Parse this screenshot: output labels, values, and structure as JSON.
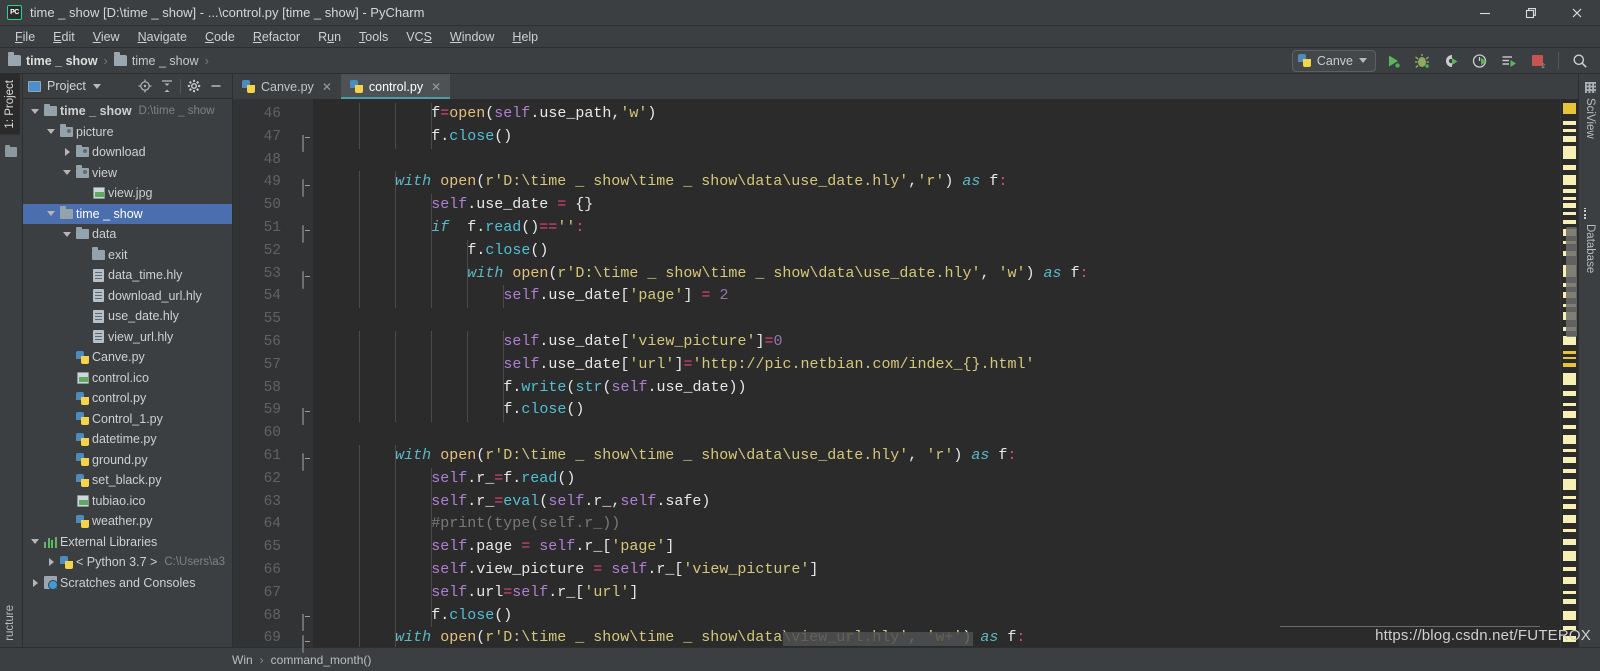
{
  "window": {
    "title": "time _ show [D:\\time _ show] - ...\\control.py [time _ show] - PyCharm",
    "logo_text": "PC",
    "minimize": "─",
    "maximize": "❐",
    "close": "✕"
  },
  "menubar": {
    "items": [
      "File",
      "Edit",
      "View",
      "Navigate",
      "Code",
      "Refactor",
      "Run",
      "Tools",
      "VCS",
      "Window",
      "Help"
    ]
  },
  "breadcrumb": {
    "items": [
      "time _ show",
      "time _ show"
    ],
    "separator": "›"
  },
  "toolbar": {
    "run_config": "Canve",
    "buttons": [
      "run-button",
      "debug-button",
      "coverage-button",
      "profile-button",
      "run-with-console-button",
      "stop-button",
      "search-everywhere-button"
    ],
    "stop_badge": "2"
  },
  "left_strip": {
    "project_tab": "1: Project",
    "structure_tab": "ructure"
  },
  "project_panel": {
    "title": "Project",
    "tree": [
      {
        "indent": 0,
        "arrow": "down",
        "icon": "folder",
        "label": "time _ show",
        "sub": "D:\\time _ show",
        "bold": true,
        "selected": false
      },
      {
        "indent": 1,
        "arrow": "down",
        "icon": "folder-src",
        "label": "picture",
        "sub": "",
        "bold": false,
        "selected": false
      },
      {
        "indent": 2,
        "arrow": "right",
        "icon": "folder-src",
        "label": "download",
        "sub": "",
        "bold": false,
        "selected": false
      },
      {
        "indent": 2,
        "arrow": "down",
        "icon": "folder-src",
        "label": "view",
        "sub": "",
        "bold": false,
        "selected": false
      },
      {
        "indent": 3,
        "arrow": "none",
        "icon": "image",
        "label": "view.jpg",
        "sub": "",
        "bold": false,
        "selected": false
      },
      {
        "indent": 1,
        "arrow": "down",
        "icon": "folder",
        "label": "time _ show",
        "sub": "",
        "bold": false,
        "selected": true
      },
      {
        "indent": 2,
        "arrow": "down",
        "icon": "folder",
        "label": "data",
        "sub": "",
        "bold": false,
        "selected": false
      },
      {
        "indent": 3,
        "arrow": "none",
        "icon": "folder",
        "label": "exit",
        "sub": "",
        "bold": false,
        "selected": false
      },
      {
        "indent": 3,
        "arrow": "none",
        "icon": "doc",
        "label": "data_time.hly",
        "sub": "",
        "bold": false,
        "selected": false
      },
      {
        "indent": 3,
        "arrow": "none",
        "icon": "doc",
        "label": "download_url.hly",
        "sub": "",
        "bold": false,
        "selected": false
      },
      {
        "indent": 3,
        "arrow": "none",
        "icon": "doc",
        "label": "use_date.hly",
        "sub": "",
        "bold": false,
        "selected": false
      },
      {
        "indent": 3,
        "arrow": "none",
        "icon": "doc",
        "label": "view_url.hly",
        "sub": "",
        "bold": false,
        "selected": false
      },
      {
        "indent": 2,
        "arrow": "none",
        "icon": "python",
        "label": "Canve.py",
        "sub": "",
        "bold": false,
        "selected": false
      },
      {
        "indent": 2,
        "arrow": "none",
        "icon": "image",
        "label": "control.ico",
        "sub": "",
        "bold": false,
        "selected": false
      },
      {
        "indent": 2,
        "arrow": "none",
        "icon": "python",
        "label": "control.py",
        "sub": "",
        "bold": false,
        "selected": false
      },
      {
        "indent": 2,
        "arrow": "none",
        "icon": "python",
        "label": "Control_1.py",
        "sub": "",
        "bold": false,
        "selected": false
      },
      {
        "indent": 2,
        "arrow": "none",
        "icon": "python",
        "label": "datetime.py",
        "sub": "",
        "bold": false,
        "selected": false
      },
      {
        "indent": 2,
        "arrow": "none",
        "icon": "python",
        "label": "ground.py",
        "sub": "",
        "bold": false,
        "selected": false
      },
      {
        "indent": 2,
        "arrow": "none",
        "icon": "python",
        "label": "set_black.py",
        "sub": "",
        "bold": false,
        "selected": false
      },
      {
        "indent": 2,
        "arrow": "none",
        "icon": "image",
        "label": "tubiao.ico",
        "sub": "",
        "bold": false,
        "selected": false
      },
      {
        "indent": 2,
        "arrow": "none",
        "icon": "python",
        "label": "weather.py",
        "sub": "",
        "bold": false,
        "selected": false
      },
      {
        "indent": 0,
        "arrow": "down",
        "icon": "library",
        "label": "External Libraries",
        "sub": "",
        "bold": false,
        "selected": false
      },
      {
        "indent": 1,
        "arrow": "right",
        "icon": "python",
        "label": "< Python 3.7 >",
        "sub": "C:\\Users\\a3",
        "bold": false,
        "selected": false
      },
      {
        "indent": 0,
        "arrow": "right",
        "icon": "scratch",
        "label": "Scratches and Consoles",
        "sub": "",
        "bold": false,
        "selected": false
      }
    ]
  },
  "editor": {
    "tabs": [
      {
        "label": "Canve.py",
        "active": false,
        "close": "✕"
      },
      {
        "label": "control.py",
        "active": true,
        "close": "✕"
      }
    ],
    "first_line": 46,
    "lines": [
      {
        "n": 46,
        "fold": "none",
        "indent": 3,
        "tokens": [
          {
            "t": "f",
            "c": "pln"
          },
          {
            "t": "=",
            "c": "op"
          },
          {
            "t": "open",
            "c": "bi"
          },
          {
            "t": "(",
            "c": "punc"
          },
          {
            "t": "self",
            "c": "slf"
          },
          {
            "t": ".use_path",
            "c": "pln"
          },
          {
            "t": ",",
            "c": "punc"
          },
          {
            "t": "'w'",
            "c": "str"
          },
          {
            "t": ")",
            "c": "punc"
          }
        ]
      },
      {
        "n": 47,
        "fold": "end",
        "indent": 3,
        "tokens": [
          {
            "t": "f.",
            "c": "pln"
          },
          {
            "t": "close",
            "c": "fn"
          },
          {
            "t": "()",
            "c": "punc"
          }
        ]
      },
      {
        "n": 48,
        "fold": "none",
        "indent": 0,
        "tokens": []
      },
      {
        "n": 49,
        "fold": "sub",
        "indent": 2,
        "tokens": [
          {
            "t": "with",
            "c": "kwc"
          },
          {
            "t": " ",
            "c": "pln"
          },
          {
            "t": "open",
            "c": "bi"
          },
          {
            "t": "(",
            "c": "punc"
          },
          {
            "t": "r'D:\\time _ show\\time _ show\\data\\use_date.hly'",
            "c": "str"
          },
          {
            "t": ",",
            "c": "punc"
          },
          {
            "t": "'r'",
            "c": "str"
          },
          {
            "t": ")",
            "c": "punc"
          },
          {
            "t": " ",
            "c": "pln"
          },
          {
            "t": "as",
            "c": "kwc"
          },
          {
            "t": " f",
            "c": "pln"
          },
          {
            "t": ":",
            "c": "op"
          }
        ]
      },
      {
        "n": 50,
        "fold": "none",
        "indent": 3,
        "tokens": [
          {
            "t": "self",
            "c": "slf"
          },
          {
            "t": ".use_date ",
            "c": "pln"
          },
          {
            "t": "=",
            "c": "op"
          },
          {
            "t": " {}",
            "c": "punc"
          }
        ]
      },
      {
        "n": 51,
        "fold": "sub",
        "indent": 3,
        "tokens": [
          {
            "t": "if",
            "c": "kwc"
          },
          {
            "t": "  f.",
            "c": "pln"
          },
          {
            "t": "read",
            "c": "fn"
          },
          {
            "t": "()",
            "c": "punc"
          },
          {
            "t": "==",
            "c": "op"
          },
          {
            "t": "''",
            "c": "str"
          },
          {
            "t": ":",
            "c": "op"
          }
        ]
      },
      {
        "n": 52,
        "fold": "none",
        "indent": 4,
        "tokens": [
          {
            "t": "f.",
            "c": "pln"
          },
          {
            "t": "close",
            "c": "fn"
          },
          {
            "t": "()",
            "c": "punc"
          }
        ]
      },
      {
        "n": 53,
        "fold": "sub",
        "indent": 4,
        "tokens": [
          {
            "t": "with",
            "c": "kwc"
          },
          {
            "t": " ",
            "c": "pln"
          },
          {
            "t": "open",
            "c": "bi"
          },
          {
            "t": "(",
            "c": "punc"
          },
          {
            "t": "r'D:\\time _ show\\time _ show\\data\\use_date.hly'",
            "c": "str"
          },
          {
            "t": ", ",
            "c": "punc"
          },
          {
            "t": "'w'",
            "c": "str"
          },
          {
            "t": ")",
            "c": "punc"
          },
          {
            "t": " ",
            "c": "pln"
          },
          {
            "t": "as",
            "c": "kwc"
          },
          {
            "t": " f",
            "c": "pln"
          },
          {
            "t": ":",
            "c": "op"
          }
        ]
      },
      {
        "n": 54,
        "fold": "none",
        "indent": 5,
        "tokens": [
          {
            "t": "self",
            "c": "slf"
          },
          {
            "t": ".use_date[",
            "c": "pln"
          },
          {
            "t": "'page'",
            "c": "str"
          },
          {
            "t": "] ",
            "c": "punc"
          },
          {
            "t": "=",
            "c": "op"
          },
          {
            "t": " ",
            "c": "pln"
          },
          {
            "t": "2",
            "c": "num"
          }
        ]
      },
      {
        "n": 55,
        "fold": "none",
        "indent": 0,
        "tokens": []
      },
      {
        "n": 56,
        "fold": "none",
        "indent": 5,
        "tokens": [
          {
            "t": "self",
            "c": "slf"
          },
          {
            "t": ".use_date[",
            "c": "pln"
          },
          {
            "t": "'view_picture'",
            "c": "str"
          },
          {
            "t": "]",
            "c": "punc"
          },
          {
            "t": "=",
            "c": "op"
          },
          {
            "t": "0",
            "c": "num"
          }
        ]
      },
      {
        "n": 57,
        "fold": "none",
        "indent": 5,
        "tokens": [
          {
            "t": "self",
            "c": "slf"
          },
          {
            "t": ".use_date[",
            "c": "pln"
          },
          {
            "t": "'url'",
            "c": "str"
          },
          {
            "t": "]",
            "c": "punc"
          },
          {
            "t": "=",
            "c": "op"
          },
          {
            "t": "'http://pic.netbian.com/index_{}.html'",
            "c": "str"
          }
        ]
      },
      {
        "n": 58,
        "fold": "none",
        "indent": 5,
        "tokens": [
          {
            "t": "f.",
            "c": "pln"
          },
          {
            "t": "write",
            "c": "fn"
          },
          {
            "t": "(",
            "c": "punc"
          },
          {
            "t": "str",
            "c": "fn"
          },
          {
            "t": "(",
            "c": "punc"
          },
          {
            "t": "self",
            "c": "slf"
          },
          {
            "t": ".use_date))",
            "c": "pln"
          }
        ]
      },
      {
        "n": 59,
        "fold": "end",
        "indent": 5,
        "tokens": [
          {
            "t": "f.",
            "c": "pln"
          },
          {
            "t": "close",
            "c": "fn"
          },
          {
            "t": "()",
            "c": "punc"
          }
        ]
      },
      {
        "n": 60,
        "fold": "none",
        "indent": 0,
        "tokens": []
      },
      {
        "n": 61,
        "fold": "sub",
        "indent": 2,
        "tokens": [
          {
            "t": "with",
            "c": "kwc"
          },
          {
            "t": " ",
            "c": "pln"
          },
          {
            "t": "open",
            "c": "bi"
          },
          {
            "t": "(",
            "c": "punc"
          },
          {
            "t": "r'D:\\time _ show\\time _ show\\data\\use_date.hly'",
            "c": "str"
          },
          {
            "t": ", ",
            "c": "punc"
          },
          {
            "t": "'r'",
            "c": "str"
          },
          {
            "t": ")",
            "c": "punc"
          },
          {
            "t": " ",
            "c": "pln"
          },
          {
            "t": "as",
            "c": "kwc"
          },
          {
            "t": " f",
            "c": "pln"
          },
          {
            "t": ":",
            "c": "op"
          }
        ]
      },
      {
        "n": 62,
        "fold": "none",
        "indent": 3,
        "tokens": [
          {
            "t": "self",
            "c": "slf"
          },
          {
            "t": ".r_",
            "c": "pln"
          },
          {
            "t": "=",
            "c": "op"
          },
          {
            "t": "f.",
            "c": "pln"
          },
          {
            "t": "read",
            "c": "fn"
          },
          {
            "t": "()",
            "c": "punc"
          }
        ]
      },
      {
        "n": 63,
        "fold": "none",
        "indent": 3,
        "tokens": [
          {
            "t": "self",
            "c": "slf"
          },
          {
            "t": ".r_",
            "c": "pln"
          },
          {
            "t": "=",
            "c": "op"
          },
          {
            "t": "eval",
            "c": "fn"
          },
          {
            "t": "(",
            "c": "punc"
          },
          {
            "t": "self",
            "c": "slf"
          },
          {
            "t": ".r_,",
            "c": "pln"
          },
          {
            "t": "self",
            "c": "slf"
          },
          {
            "t": ".safe)",
            "c": "pln"
          }
        ]
      },
      {
        "n": 64,
        "fold": "none",
        "indent": 3,
        "tokens": [
          {
            "t": "#print(type(self.r_))",
            "c": "cmt"
          }
        ]
      },
      {
        "n": 65,
        "fold": "none",
        "indent": 3,
        "tokens": [
          {
            "t": "self",
            "c": "slf"
          },
          {
            "t": ".page ",
            "c": "pln"
          },
          {
            "t": "=",
            "c": "op"
          },
          {
            "t": " ",
            "c": "pln"
          },
          {
            "t": "self",
            "c": "slf"
          },
          {
            "t": ".r_[",
            "c": "pln"
          },
          {
            "t": "'page'",
            "c": "str"
          },
          {
            "t": "]",
            "c": "punc"
          }
        ]
      },
      {
        "n": 66,
        "fold": "none",
        "indent": 3,
        "tokens": [
          {
            "t": "self",
            "c": "slf"
          },
          {
            "t": ".view_picture ",
            "c": "pln"
          },
          {
            "t": "=",
            "c": "op"
          },
          {
            "t": " ",
            "c": "pln"
          },
          {
            "t": "self",
            "c": "slf"
          },
          {
            "t": ".r_[",
            "c": "pln"
          },
          {
            "t": "'view_picture'",
            "c": "str"
          },
          {
            "t": "]",
            "c": "punc"
          }
        ]
      },
      {
        "n": 67,
        "fold": "none",
        "indent": 3,
        "tokens": [
          {
            "t": "self",
            "c": "slf"
          },
          {
            "t": ".url",
            "c": "pln"
          },
          {
            "t": "=",
            "c": "op"
          },
          {
            "t": "self",
            "c": "slf"
          },
          {
            "t": ".r_[",
            "c": "pln"
          },
          {
            "t": "'url'",
            "c": "str"
          },
          {
            "t": "]",
            "c": "punc"
          }
        ]
      },
      {
        "n": 68,
        "fold": "end",
        "indent": 3,
        "tokens": [
          {
            "t": "f.",
            "c": "pln"
          },
          {
            "t": "close",
            "c": "fn"
          },
          {
            "t": "()",
            "c": "punc"
          }
        ]
      },
      {
        "n": 69,
        "fold": "sub",
        "indent": 2,
        "tokens": [
          {
            "t": "with",
            "c": "kwc"
          },
          {
            "t": " ",
            "c": "pln"
          },
          {
            "t": "open",
            "c": "bi"
          },
          {
            "t": "(",
            "c": "punc"
          },
          {
            "t": "r'D:\\time _ show\\time _ show\\data\\view_url.hly'",
            "c": "str"
          },
          {
            "t": ", ",
            "c": "punc"
          },
          {
            "t": "'w+'",
            "c": "str"
          },
          {
            "t": ")",
            "c": "punc"
          },
          {
            "t": " ",
            "c": "pln"
          },
          {
            "t": "as",
            "c": "kwc"
          },
          {
            "t": " f",
            "c": "pln"
          },
          {
            "t": ":",
            "c": "op"
          }
        ]
      }
    ]
  },
  "right_strip": {
    "sciview_tab": "SciView",
    "database_tab": "Database"
  },
  "statusbar": {
    "encoding": "Win",
    "separator": "›",
    "context": "command_month()"
  },
  "watermark": "https://blog.csdn.net/FUTEROX",
  "colors": {
    "panel_bg": "#3c3f41",
    "editor_bg": "#2b2b2b",
    "gutter_bg": "#313335",
    "selection_blue": "#4b6eaf",
    "tab_underline": "#4e9ba5",
    "keyword": "#5fb8c4",
    "string": "#d4c87a",
    "self": "#b07fd4",
    "number": "#9876aa",
    "function": "#4fc1d4",
    "operator": "#e0457b",
    "builtin": "#e5c07b",
    "comment": "#7a7a7a"
  }
}
